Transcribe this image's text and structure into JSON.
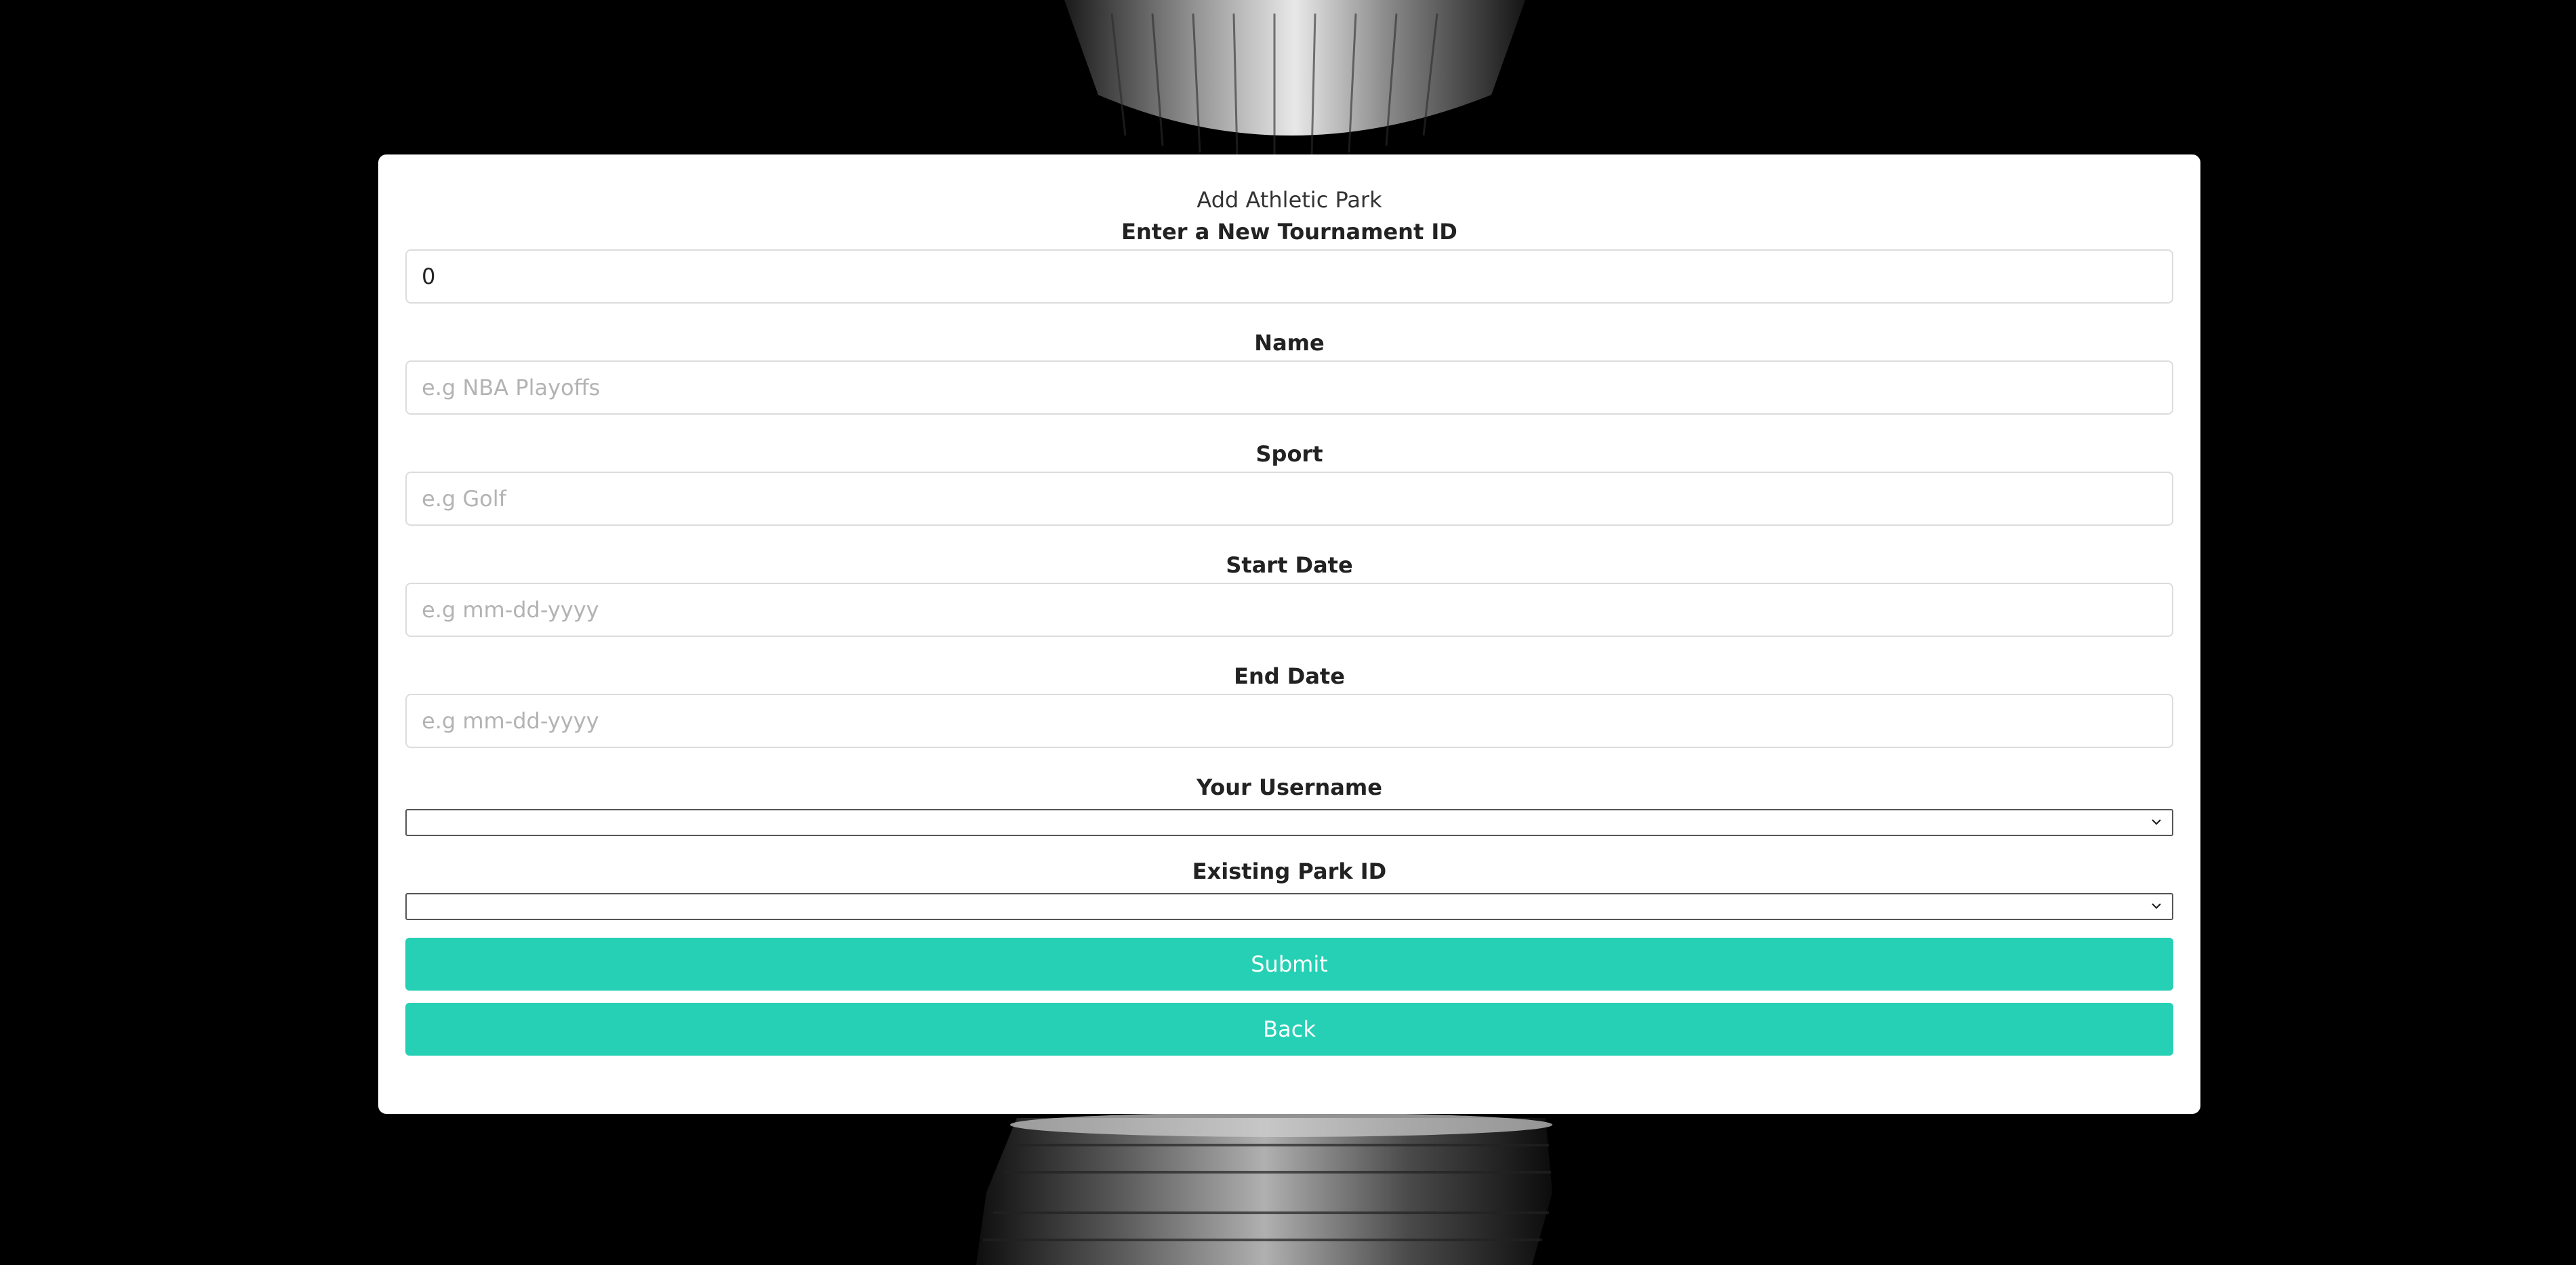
{
  "colors": {
    "background": "#000000",
    "card": "#ffffff",
    "accent": "#26d0b4"
  },
  "form": {
    "title": "Add Athletic Park",
    "fields": {
      "tournament_id": {
        "label": "Enter a New Tournament ID",
        "value": "0"
      },
      "name": {
        "label": "Name",
        "placeholder": "e.g NBA Playoffs"
      },
      "sport": {
        "label": "Sport",
        "placeholder": "e.g Golf"
      },
      "start_date": {
        "label": "Start Date",
        "placeholder": "e.g mm-dd-yyyy"
      },
      "end_date": {
        "label": "End Date",
        "placeholder": "e.g mm-dd-yyyy"
      },
      "username": {
        "label": "Your Username",
        "selected": ""
      },
      "park_id": {
        "label": "Existing Park ID",
        "selected": ""
      }
    },
    "buttons": {
      "submit": "Submit",
      "back": "Back"
    }
  },
  "icons": {
    "select_chevron": "chevron-down-icon",
    "background_image": "trophy-image"
  }
}
